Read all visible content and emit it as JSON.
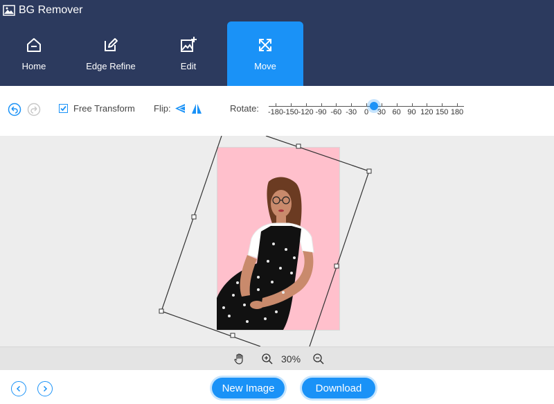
{
  "app": {
    "title": "BG Remover"
  },
  "tabs": [
    {
      "label": "Home",
      "icon": "home-icon",
      "active": false
    },
    {
      "label": "Edge Refine",
      "icon": "edit-pencil-icon",
      "active": false
    },
    {
      "label": "Edit",
      "icon": "image-edit-icon",
      "active": false
    },
    {
      "label": "Move",
      "icon": "move-arrows-icon",
      "active": true
    }
  ],
  "toolbar": {
    "undo_icon": "undo-icon",
    "redo_icon": "redo-icon",
    "free_transform_label": "Free Transform",
    "free_transform_checked": true,
    "flip_label": "Flip:",
    "rotate_label": "Rotate:",
    "rotate_ticks": [
      "-180",
      "-150",
      "-120",
      "-90",
      "-60",
      "-30",
      "0",
      "30",
      "60",
      "90",
      "120",
      "150",
      "180"
    ],
    "rotate_value": 15
  },
  "zoom": {
    "value": "30%"
  },
  "bottom": {
    "new_image_label": "New Image",
    "download_label": "Download"
  },
  "colors": {
    "header_bg": "#2c3a5e",
    "accent": "#1a92f7",
    "image_bg": "#ffc0cc"
  }
}
